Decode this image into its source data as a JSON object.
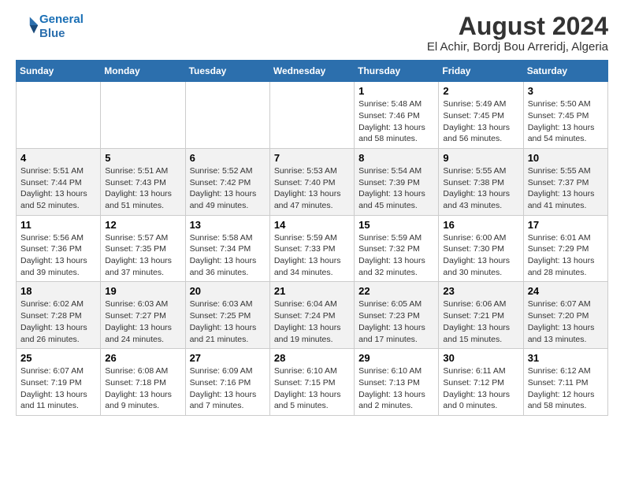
{
  "header": {
    "logo_line1": "General",
    "logo_line2": "Blue",
    "title": "August 2024",
    "subtitle": "El Achir, Bordj Bou Arreridj, Algeria"
  },
  "weekdays": [
    "Sunday",
    "Monday",
    "Tuesday",
    "Wednesday",
    "Thursday",
    "Friday",
    "Saturday"
  ],
  "weeks": [
    [
      {
        "day": "",
        "info": ""
      },
      {
        "day": "",
        "info": ""
      },
      {
        "day": "",
        "info": ""
      },
      {
        "day": "",
        "info": ""
      },
      {
        "day": "1",
        "info": "Sunrise: 5:48 AM\nSunset: 7:46 PM\nDaylight: 13 hours\nand 58 minutes."
      },
      {
        "day": "2",
        "info": "Sunrise: 5:49 AM\nSunset: 7:45 PM\nDaylight: 13 hours\nand 56 minutes."
      },
      {
        "day": "3",
        "info": "Sunrise: 5:50 AM\nSunset: 7:45 PM\nDaylight: 13 hours\nand 54 minutes."
      }
    ],
    [
      {
        "day": "4",
        "info": "Sunrise: 5:51 AM\nSunset: 7:44 PM\nDaylight: 13 hours\nand 52 minutes."
      },
      {
        "day": "5",
        "info": "Sunrise: 5:51 AM\nSunset: 7:43 PM\nDaylight: 13 hours\nand 51 minutes."
      },
      {
        "day": "6",
        "info": "Sunrise: 5:52 AM\nSunset: 7:42 PM\nDaylight: 13 hours\nand 49 minutes."
      },
      {
        "day": "7",
        "info": "Sunrise: 5:53 AM\nSunset: 7:40 PM\nDaylight: 13 hours\nand 47 minutes."
      },
      {
        "day": "8",
        "info": "Sunrise: 5:54 AM\nSunset: 7:39 PM\nDaylight: 13 hours\nand 45 minutes."
      },
      {
        "day": "9",
        "info": "Sunrise: 5:55 AM\nSunset: 7:38 PM\nDaylight: 13 hours\nand 43 minutes."
      },
      {
        "day": "10",
        "info": "Sunrise: 5:55 AM\nSunset: 7:37 PM\nDaylight: 13 hours\nand 41 minutes."
      }
    ],
    [
      {
        "day": "11",
        "info": "Sunrise: 5:56 AM\nSunset: 7:36 PM\nDaylight: 13 hours\nand 39 minutes."
      },
      {
        "day": "12",
        "info": "Sunrise: 5:57 AM\nSunset: 7:35 PM\nDaylight: 13 hours\nand 37 minutes."
      },
      {
        "day": "13",
        "info": "Sunrise: 5:58 AM\nSunset: 7:34 PM\nDaylight: 13 hours\nand 36 minutes."
      },
      {
        "day": "14",
        "info": "Sunrise: 5:59 AM\nSunset: 7:33 PM\nDaylight: 13 hours\nand 34 minutes."
      },
      {
        "day": "15",
        "info": "Sunrise: 5:59 AM\nSunset: 7:32 PM\nDaylight: 13 hours\nand 32 minutes."
      },
      {
        "day": "16",
        "info": "Sunrise: 6:00 AM\nSunset: 7:30 PM\nDaylight: 13 hours\nand 30 minutes."
      },
      {
        "day": "17",
        "info": "Sunrise: 6:01 AM\nSunset: 7:29 PM\nDaylight: 13 hours\nand 28 minutes."
      }
    ],
    [
      {
        "day": "18",
        "info": "Sunrise: 6:02 AM\nSunset: 7:28 PM\nDaylight: 13 hours\nand 26 minutes."
      },
      {
        "day": "19",
        "info": "Sunrise: 6:03 AM\nSunset: 7:27 PM\nDaylight: 13 hours\nand 24 minutes."
      },
      {
        "day": "20",
        "info": "Sunrise: 6:03 AM\nSunset: 7:25 PM\nDaylight: 13 hours\nand 21 minutes."
      },
      {
        "day": "21",
        "info": "Sunrise: 6:04 AM\nSunset: 7:24 PM\nDaylight: 13 hours\nand 19 minutes."
      },
      {
        "day": "22",
        "info": "Sunrise: 6:05 AM\nSunset: 7:23 PM\nDaylight: 13 hours\nand 17 minutes."
      },
      {
        "day": "23",
        "info": "Sunrise: 6:06 AM\nSunset: 7:21 PM\nDaylight: 13 hours\nand 15 minutes."
      },
      {
        "day": "24",
        "info": "Sunrise: 6:07 AM\nSunset: 7:20 PM\nDaylight: 13 hours\nand 13 minutes."
      }
    ],
    [
      {
        "day": "25",
        "info": "Sunrise: 6:07 AM\nSunset: 7:19 PM\nDaylight: 13 hours\nand 11 minutes."
      },
      {
        "day": "26",
        "info": "Sunrise: 6:08 AM\nSunset: 7:18 PM\nDaylight: 13 hours\nand 9 minutes."
      },
      {
        "day": "27",
        "info": "Sunrise: 6:09 AM\nSunset: 7:16 PM\nDaylight: 13 hours\nand 7 minutes."
      },
      {
        "day": "28",
        "info": "Sunrise: 6:10 AM\nSunset: 7:15 PM\nDaylight: 13 hours\nand 5 minutes."
      },
      {
        "day": "29",
        "info": "Sunrise: 6:10 AM\nSunset: 7:13 PM\nDaylight: 13 hours\nand 2 minutes."
      },
      {
        "day": "30",
        "info": "Sunrise: 6:11 AM\nSunset: 7:12 PM\nDaylight: 13 hours\nand 0 minutes."
      },
      {
        "day": "31",
        "info": "Sunrise: 6:12 AM\nSunset: 7:11 PM\nDaylight: 12 hours\nand 58 minutes."
      }
    ]
  ]
}
